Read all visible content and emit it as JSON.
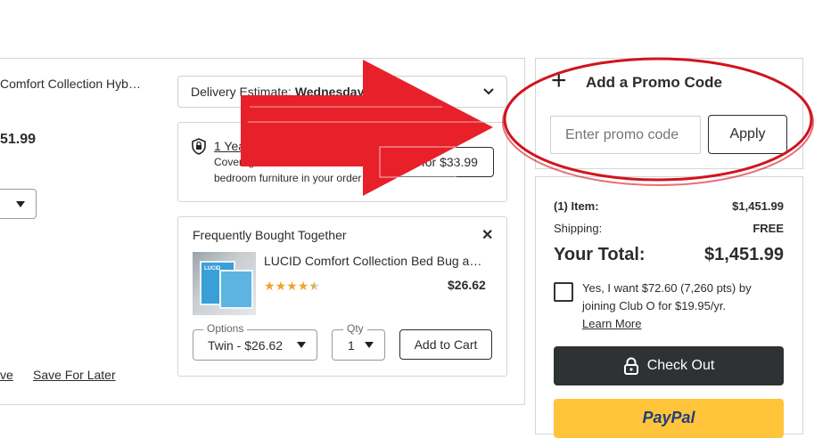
{
  "product": {
    "title": "Comfort Collection Hyb…",
    "price": "51.99"
  },
  "delivery": {
    "label": "Delivery Estimate: ",
    "date": "Wednesday, Mar 8"
  },
  "service_plan": {
    "title": "1 Year Service Plan",
    "line1": "Coverage for accidents and",
    "line2": "bedroom furniture in your order",
    "add_label": "Add for $33.99"
  },
  "fbt": {
    "heading": "Frequently Bought Together",
    "close": "✕",
    "item_title": "LUCID Comfort Collection Bed Bug a…",
    "item_price": "$26.62",
    "rating": 4.5,
    "options_label": "Options",
    "option_value": "Twin - $26.62",
    "qty_label": "Qty",
    "qty_value": "1",
    "add_to_cart": "Add to Cart",
    "thumb_text": "LUCID"
  },
  "cart_actions": {
    "remove": "ve",
    "save_for_later": "Save For Later"
  },
  "promo": {
    "heading": "Add a Promo Code",
    "plus": "+",
    "placeholder": "Enter promo code",
    "apply": "Apply"
  },
  "summary": {
    "items_label": "(1) Item:",
    "items_value": "$1,451.99",
    "shipping_label": "Shipping:",
    "shipping_value": "FREE",
    "total_label": "Your Total:",
    "total_value": "$1,451.99",
    "club_o_line1": "Yes, I want $72.60 (7,260 pts) by",
    "club_o_line2": "joining Club O for $19.95/yr.",
    "learn_more": "Learn More",
    "checkout": "Check Out",
    "paypal": "PayPal"
  },
  "colors": {
    "annotation_red": "#e8202a",
    "checkout_bg": "#2f3234",
    "paypal_bg": "#ffc43a",
    "star": "#f0a32b"
  }
}
